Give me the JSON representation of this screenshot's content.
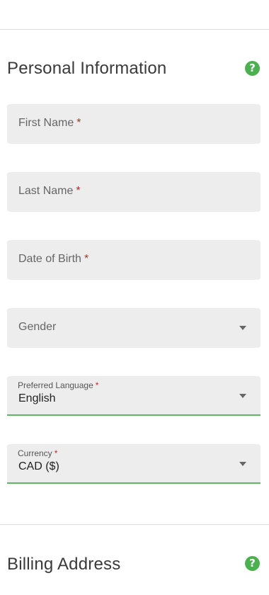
{
  "personal_section": {
    "title": "Personal Information",
    "help_icon_glyph": "?",
    "help_icon": "question-circle-icon",
    "fields": {
      "first_name": {
        "label": "First Name",
        "required_mark": "*"
      },
      "last_name": {
        "label": "Last Name",
        "required_mark": "*"
      },
      "date_of_birth": {
        "label": "Date of Birth",
        "required_mark": "*"
      },
      "gender": {
        "label": "Gender"
      },
      "preferred_language": {
        "label": "Preferred Language",
        "required_mark": "*",
        "value": "English"
      },
      "currency": {
        "label": "Currency",
        "required_mark": "*",
        "value": "CAD ($)"
      }
    }
  },
  "billing_section": {
    "title": "Billing Address",
    "help_icon_glyph": "?",
    "help_icon": "question-circle-icon"
  },
  "colors": {
    "accent_green": "#5cb85c",
    "help_icon_green": "#4caf50",
    "required_red": "#c62828",
    "field_bg": "#ededed"
  }
}
